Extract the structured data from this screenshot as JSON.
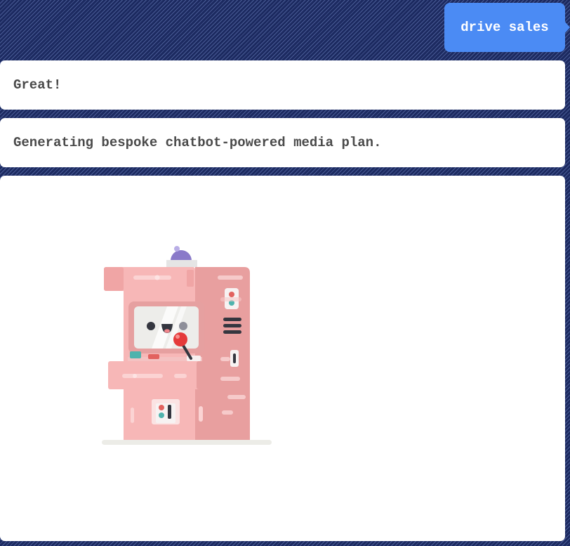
{
  "chat": {
    "user_message": "drive sales",
    "bot_messages": [
      "Great!",
      "Generating bespoke chatbot-powered media plan."
    ],
    "illustration_icon": "arcade-machine-icon"
  },
  "colors": {
    "user_bubble": "#4b8bf4",
    "bot_bubble": "#ffffff",
    "bot_text": "#4a4a4a",
    "background": "#1c2a60"
  }
}
